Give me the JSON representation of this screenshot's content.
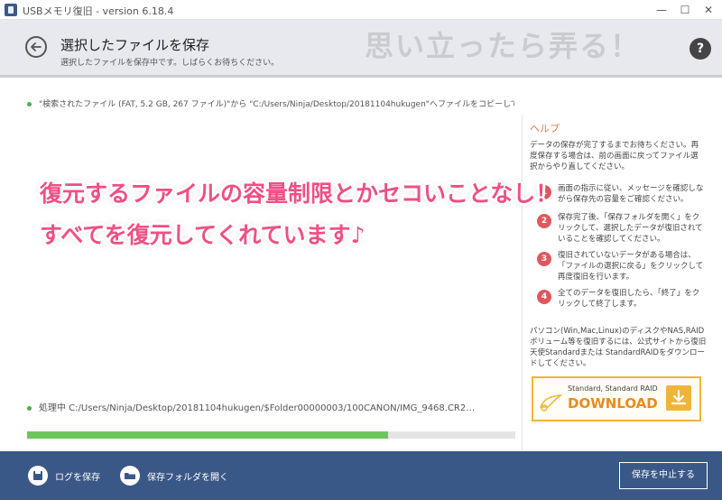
{
  "window": {
    "title": "USBメモリ復旧 - version 6.18.4",
    "minimize": "—",
    "maximize": "☐",
    "close": "✕"
  },
  "header": {
    "title": "選択したファイルを保存",
    "subtitle": "選択したファイルを保存中です。しばらくお待ちください。",
    "help_label": "?",
    "watermark": "思い立ったら弄る！"
  },
  "main": {
    "status": "\"検索されたファイル (FAT, 5.2 GB, 267 ファイル)\"から \"C:/Users/Ninja/Desktop/20181104hukugen\"へファイルをコピーしています…",
    "processing": "処理中 C:/Users/Ninja/Desktop/20181104hukugen/$Folder00000003/100CANON/IMG_9468.CR2…",
    "progress": 0.74
  },
  "help": {
    "heading": "ヘルプ",
    "intro": "データの保存が完了するまでお待ちください。再度保存する場合は、前の画面に戻ってファイル選択からやり直してください。",
    "steps": [
      {
        "num": "1",
        "text": "画面の指示に従い、メッセージを確認しながら保存先の容量をご確認ください。"
      },
      {
        "num": "2",
        "text": "保存完了後、「保存フォルダを開く」をクリックして、選択したデータが復旧されていることを確認してください。"
      },
      {
        "num": "3",
        "text": "復旧されていないデータがある場合は、「ファイルの選択に戻る」をクリックして再度復旧を行います。"
      },
      {
        "num": "4",
        "text": "全てのデータを復旧したら、「終了」をクリックして終了します。"
      }
    ],
    "note": "パソコン(Win,Mac,Linux)のディスクやNAS,RAIDボリューム等を復旧するには、公式サイトから復旧天使Standardまたは StandardRAIDをダウンロードしてください。",
    "banner_plan": "Standard, Standard RAID",
    "banner_download": "DOWNLOAD"
  },
  "overlay": {
    "line1": "復元するファイルの容量制限とかセコいことなし！",
    "line2": "すべてを復元してくれています♪"
  },
  "footer": {
    "save_log": "ログを保存",
    "open_folder": "保存フォルダを開く",
    "stop_save": "保存を中止する"
  },
  "colors": {
    "footer_bg": "#3a5887",
    "progress": "#6cc65b",
    "help_accent": "#e07755",
    "step_badge": "#e0585d",
    "overlay_text": "#ef4f86",
    "download": "#e98a1f"
  }
}
